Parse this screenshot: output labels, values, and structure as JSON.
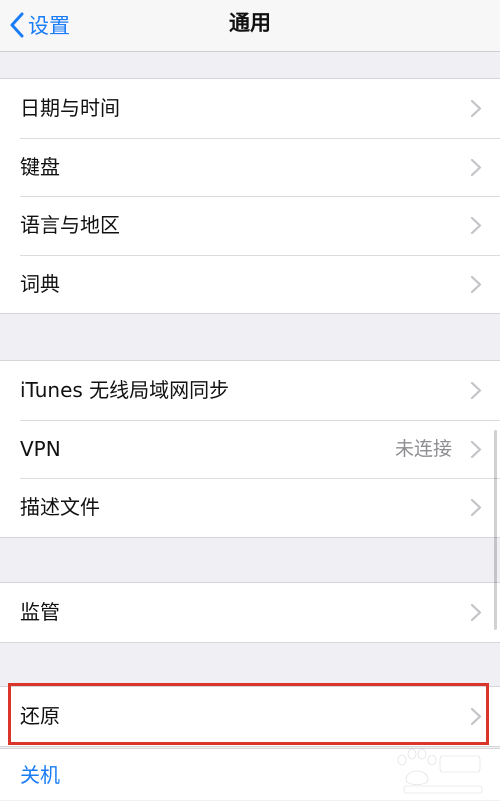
{
  "navbar": {
    "back_label": "设置",
    "title": "通用"
  },
  "groups": [
    {
      "items": [
        {
          "label": "日期与时间"
        },
        {
          "label": "键盘"
        },
        {
          "label": "语言与地区"
        },
        {
          "label": "词典"
        }
      ]
    },
    {
      "items": [
        {
          "label": "iTunes 无线局域网同步"
        },
        {
          "label": "VPN",
          "value": "未连接"
        },
        {
          "label": "描述文件"
        }
      ]
    },
    {
      "items": [
        {
          "label": "监管"
        }
      ]
    },
    {
      "items": [
        {
          "label": "还原"
        }
      ]
    }
  ],
  "shutdown": {
    "label": "关机"
  },
  "colors": {
    "accent": "#1a7cf7",
    "highlight": "#d9352a",
    "background": "#efeff4"
  },
  "icons": {
    "back": "chevron-left-icon",
    "row": "chevron-right-icon",
    "watermark": "baidu-paw-logo"
  }
}
